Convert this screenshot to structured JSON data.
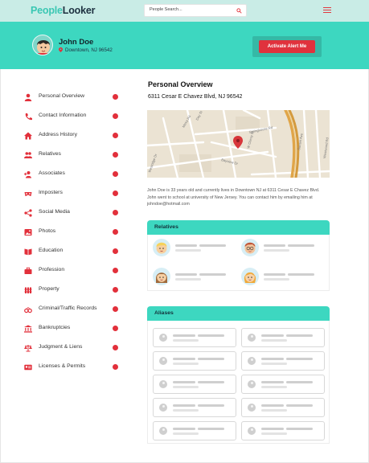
{
  "brand": {
    "part1": "People",
    "part2": "Looker"
  },
  "search": {
    "placeholder": "People Search..."
  },
  "person": {
    "name": "John Doe",
    "location": "Downtown, NJ 96542"
  },
  "alert_button": {
    "label": "Activate Alert Me"
  },
  "sidebar": {
    "items": [
      {
        "label": "Personal Overview",
        "icon": "person-icon"
      },
      {
        "label": "Contact Information",
        "icon": "phone-icon"
      },
      {
        "label": "Address History",
        "icon": "house-icon"
      },
      {
        "label": "Relatives",
        "icon": "group-icon"
      },
      {
        "label": "Associates",
        "icon": "add-person-icon"
      },
      {
        "label": "Imposters",
        "icon": "mask-icon"
      },
      {
        "label": "Social Media",
        "icon": "share-icon"
      },
      {
        "label": "Photos",
        "icon": "image-icon"
      },
      {
        "label": "Education",
        "icon": "book-icon"
      },
      {
        "label": "Profession",
        "icon": "briefcase-icon"
      },
      {
        "label": "Property",
        "icon": "fence-icon"
      },
      {
        "label": "Criminal/Traffic Records",
        "icon": "handcuffs-icon"
      },
      {
        "label": "Bankruptcies",
        "icon": "bank-icon"
      },
      {
        "label": "Judgment & Liens",
        "icon": "scale-icon"
      },
      {
        "label": "Licenses & Permits",
        "icon": "id-card-icon"
      }
    ],
    "dot_color": "#e2303b"
  },
  "main": {
    "title": "Personal Overview",
    "address": "6311 Cesar E Chavez Blvd, NJ 96542",
    "map_labels": [
      "Mesa Rd",
      "Day St",
      "Springhouse Rd",
      "Bayview Dr",
      "W Chevy St",
      "Sunset Ave",
      "Westwood Rd",
      "Westridge Dr"
    ],
    "bio": "John Doe is 33 years old and currently lives in Downtown NJ at 6311 Cesar E Chavez Blvd. John went to school at university of New Jersey. You can contact him by emailing him at johndoe@hotmail.com",
    "relatives_title": "Relatives",
    "aliases_title": "Aliases"
  },
  "colors": {
    "accent": "#3dd7c0",
    "alert": "#e0323d",
    "topbar": "#c9ece6"
  }
}
